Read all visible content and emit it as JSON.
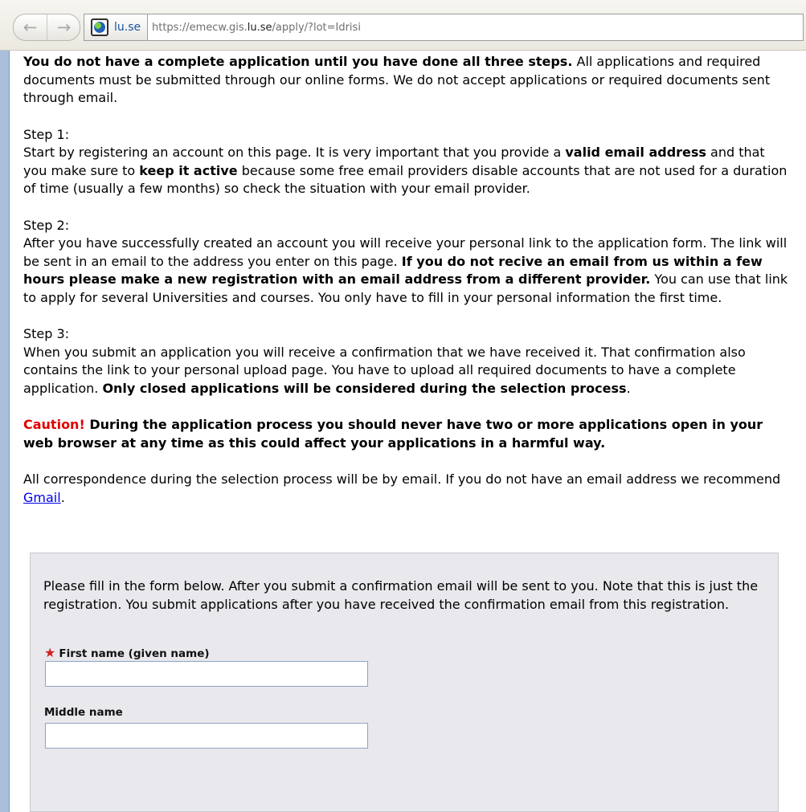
{
  "browser": {
    "back_icon": "back-arrow-icon",
    "forward_icon": "forward-arrow-icon",
    "site_identity_label": "lu.se",
    "url_prefix": "https://emecw.gis.",
    "url_host": "lu.se",
    "url_suffix": "/apply/?lot=Idrisi"
  },
  "intro": {
    "lead_bold": "You do not have a complete application until you have done all three steps.",
    "lead_text": " All applications and required documents must be submitted through our online forms. We do not accept applications or required documents sent through email."
  },
  "step1": {
    "heading": "Step 1:",
    "text_a": "Start by registering an account on this page. It is very important that you provide a ",
    "bold_a": "valid email address",
    "text_b": " and that you make sure to ",
    "bold_b": "keep it active",
    "text_c": " because some free email providers disable accounts that are not used for a duration of time (usually a few months) so check the situation with your email provider."
  },
  "step2": {
    "heading": "Step 2:",
    "text_a": "After you have successfully created an account you will receive your personal link to the application form. The link will be sent in an email to the address you enter on this page. ",
    "bold_a": "If you do not recive an email from us within a few hours please make a new registration with an email address from a different provider.",
    "text_b": " You can use that link to apply for several Universities and courses. You only have to fill in your personal information the first time."
  },
  "step3": {
    "heading": "Step 3:",
    "text_a": "When you submit an application you will receive a confirmation that we have received it. That confirmation also contains the link to your personal upload page. You have to upload all required documents to have a complete application. ",
    "bold_a": "Only closed applications will be considered during the selection process",
    "text_b": "."
  },
  "caution": {
    "label": "Caution!",
    "text": " During the application process you should never have two or more applications open in your web browser at any time as this could affect your applications in a harmful way."
  },
  "correspondence": {
    "text": "All correspondence during the selection process will be by email. If you do not have an email address we recommend ",
    "link": "Gmail",
    "end": "."
  },
  "form": {
    "intro": "Please fill in the form below. After you submit a confirmation email will be sent to you. Note that this is just the registration. You submit applications after you have received the confirmation email from this registration.",
    "first_name_label": "First name (given name)",
    "first_name_value": "",
    "middle_name_label": "Middle name",
    "middle_name_value": ""
  },
  "colors": {
    "caution": "#e00000",
    "link": "#0000ee",
    "sidebar": "#a9bfdc",
    "required_star": "#d31f1f",
    "form_panel": "#e8e8ed"
  }
}
